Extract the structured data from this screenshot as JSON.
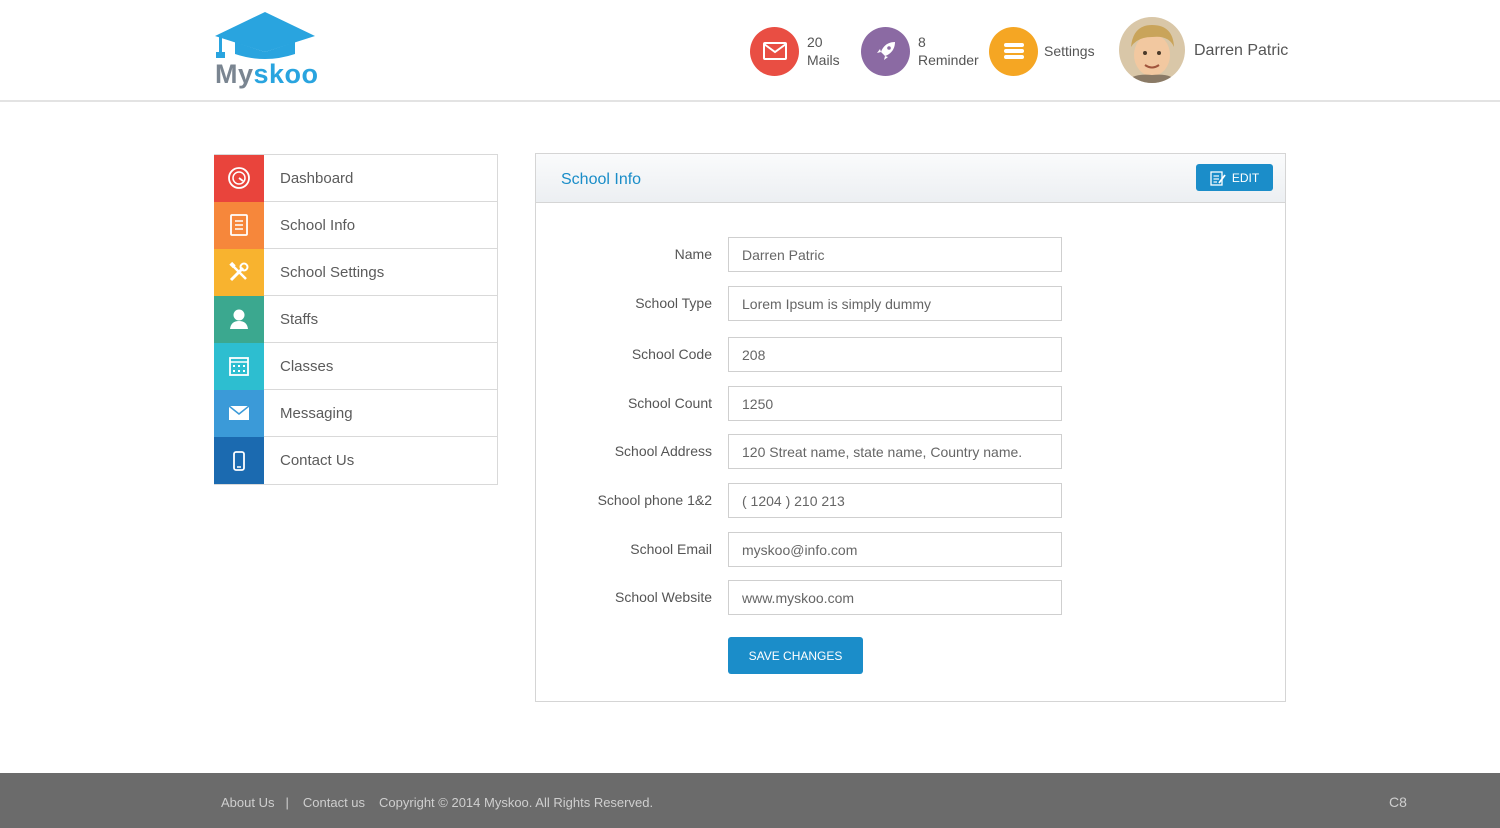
{
  "brand": {
    "name_part1": "My",
    "name_part2": "skoo",
    "accent": "#29a4df"
  },
  "header": {
    "mails": {
      "count": "20",
      "label": "Mails",
      "color": "#e94e43",
      "icon": "envelope-icon"
    },
    "reminder": {
      "count": "8",
      "label": "Reminder",
      "color": "#8b6aa3",
      "icon": "rocket-icon"
    },
    "settings": {
      "label": "Settings",
      "color": "#f5a623",
      "icon": "menu-icon"
    },
    "user": {
      "name": "Darren Patric"
    }
  },
  "sidebar": {
    "items": [
      {
        "label": "Dashboard",
        "color": "#e9443c",
        "icon": "dashboard-icon"
      },
      {
        "label": "School Info",
        "color": "#f6873b",
        "icon": "document-icon"
      },
      {
        "label": "School Settings",
        "color": "#f8b32f",
        "icon": "tools-icon"
      },
      {
        "label": "Staffs",
        "color": "#3ba88f",
        "icon": "user-icon"
      },
      {
        "label": "Classes",
        "color": "#2dbed0",
        "icon": "calendar-icon"
      },
      {
        "label": "Messaging",
        "color": "#3b9ad8",
        "icon": "envelope-icon"
      },
      {
        "label": "Contact Us",
        "color": "#1b6ab0",
        "icon": "phone-icon"
      }
    ]
  },
  "panel": {
    "title": "School Info",
    "edit_label": "EDIT",
    "fields": [
      {
        "label": "Name",
        "value": "Darren Patric"
      },
      {
        "label": "School Type",
        "value": "Lorem Ipsum is simply dummy"
      },
      {
        "label": "School Code",
        "value": "208"
      },
      {
        "label": "School Count",
        "value": "1250"
      },
      {
        "label": "School Address",
        "value": "120 Streat name, state name, Country name."
      },
      {
        "label": "School phone 1&2",
        "value": "( 1204 ) 210 213"
      },
      {
        "label": "School Email",
        "value": "myskoo@info.com"
      },
      {
        "label": "School Website",
        "value": "www.myskoo.com"
      }
    ],
    "save_label": "SAVE CHANGES"
  },
  "footer": {
    "about": "About Us",
    "separator": "|",
    "contact": "Contact us",
    "copyright": "Copyright © 2014 Myskoo. All Rights Reserved.",
    "code": "C8"
  }
}
